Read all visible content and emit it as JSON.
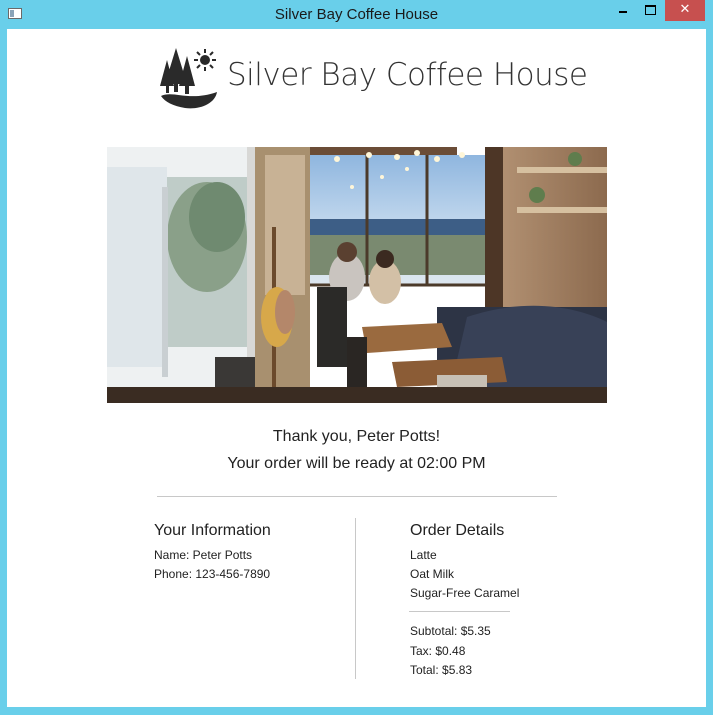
{
  "window": {
    "title": "Silver Bay Coffee House",
    "close_glyph": "✕"
  },
  "brand": {
    "name": "Silver Bay Coffee House",
    "logo_icon": "trees-sun-logo-icon"
  },
  "photo": {
    "description_icon": "cafe-interior-photo"
  },
  "confirmation": {
    "thanks": "Thank you, Peter Potts!",
    "ready": "Your order will be ready at 02:00 PM"
  },
  "info": {
    "title": "Your Information",
    "name": "Name: Peter Potts",
    "phone": "Phone: 123-456-7890"
  },
  "order": {
    "title": "Order Details",
    "items": [
      "Latte",
      "Oat Milk",
      "Sugar-Free Caramel"
    ],
    "subtotal": "Subtotal: $5.35",
    "tax": "Tax: $0.48",
    "total": "Total: $5.83"
  },
  "colors": {
    "window_frame": "#69cfea",
    "close_button": "#c7504f",
    "logo": "#2a2a2a"
  }
}
